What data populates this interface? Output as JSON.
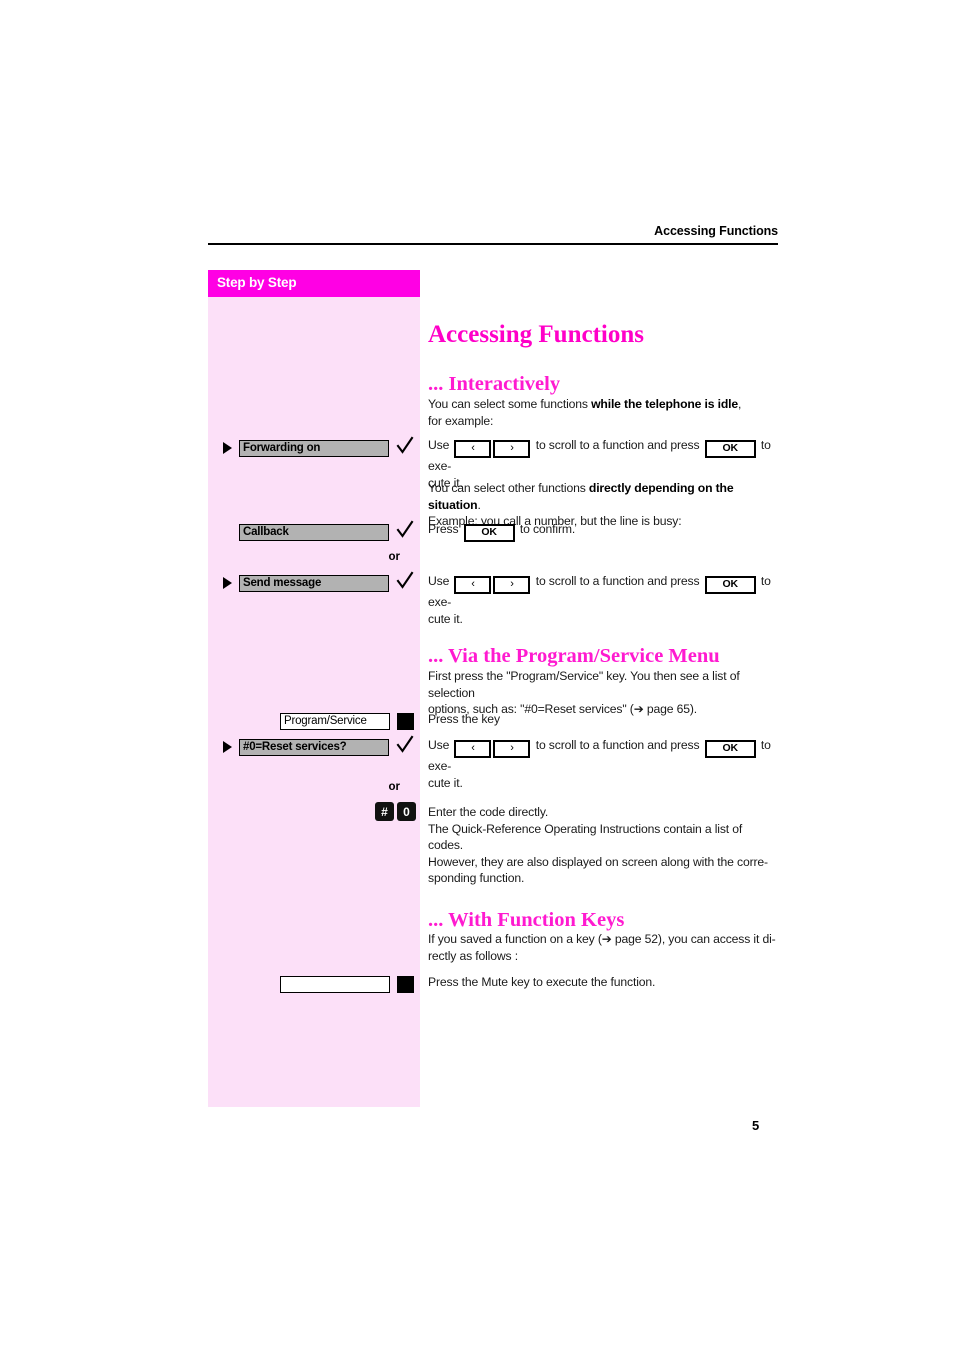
{
  "header": {
    "running_head": "Accessing Functions"
  },
  "sidebar": {
    "title": "Step by Step",
    "bg_color": "#fce0f8",
    "title_bg_color": "#ff00e4",
    "items": [
      {
        "label": "Forwarding on",
        "type": "display",
        "bullet": true,
        "check": true
      },
      {
        "label": "Callback",
        "type": "display",
        "bullet": false,
        "check": true
      },
      {
        "label": "Send message",
        "type": "display",
        "bullet": true,
        "check": true
      },
      {
        "label": "Program/Service",
        "type": "key",
        "bullet": false,
        "check": false
      },
      {
        "label": "#0=Reset services?",
        "type": "display",
        "bullet": true,
        "check": true
      },
      {
        "label": "",
        "type": "key-blank",
        "bullet": false,
        "check": false
      }
    ],
    "or_separators": [
      "or",
      "or"
    ],
    "keypad_keys": [
      "#",
      "0"
    ]
  },
  "main": {
    "title": "Accessing Functions",
    "sections": [
      {
        "heading": "... Interactively",
        "paragraphs": [
          {
            "id": "p1_a",
            "text": "You can select some functions ",
            "bold": "while the telephone is idle",
            "tail": ","
          },
          {
            "id": "p1_b",
            "text": "for example:"
          },
          {
            "id": "p2_a",
            "pre": "Use ",
            "mid": " to scroll to a function and press ",
            "post": " to exe-"
          },
          {
            "id": "p2_b",
            "text": "cute it."
          },
          {
            "id": "p3_a",
            "text": "You can select other functions ",
            "bold": "directly depending on the situation",
            "tail": "."
          },
          {
            "id": "p3_b",
            "text": "Example:  you call a number, but the line is busy:"
          },
          {
            "id": "p4",
            "pre": "Press ",
            "post": " to confirm."
          },
          {
            "id": "p5_a",
            "pre": "Use ",
            "mid": " to scroll to a function and press ",
            "post": " to exe-"
          },
          {
            "id": "p5_b",
            "text": "cute it."
          }
        ]
      },
      {
        "heading": "... Via the Program/Service Menu",
        "paragraphs": [
          {
            "id": "p6_a",
            "text": "First press the \"Program/Service\" key. You then see a list of selection"
          },
          {
            "id": "p6_b",
            "pre": "options, such as: \"#0=Reset services\" (",
            "post": " page 65)."
          },
          {
            "id": "p7",
            "text": "Press the key"
          },
          {
            "id": "p8_a",
            "pre": "Use ",
            "mid": " to scroll to a function and press ",
            "post": " to exe-"
          },
          {
            "id": "p8_b",
            "text": "cute it."
          },
          {
            "id": "p9_a",
            "text": "Enter the code directly."
          },
          {
            "id": "p9_b",
            "text": "The Quick-Reference Operating Instructions contain a list of codes."
          },
          {
            "id": "p9_c",
            "text": "However, they are also displayed on screen along with the corre-"
          },
          {
            "id": "p9_d",
            "text": "sponding function."
          }
        ]
      },
      {
        "heading": "... With Function Keys",
        "paragraphs": [
          {
            "id": "p10_a",
            "pre": "If you saved a function on a key (",
            "post": " page 52), you can access it di-"
          },
          {
            "id": "p10_b",
            "text": "rectly as follows :"
          },
          {
            "id": "p11",
            "text": "Press the Mute key to execute the function."
          }
        ]
      }
    ],
    "buttons": {
      "ok_label": "OK",
      "nav_left": "‹",
      "nav_right": "›",
      "page_arrow": "➔"
    }
  },
  "footer": {
    "page_number": "5"
  },
  "colors": {
    "magenta_heading": "#ff00c8",
    "magenta_bar": "#ff00e4",
    "sidebar_pink": "#fce0f8",
    "display_grey": "#b2b2b2",
    "text_black": "#1a1a1a"
  }
}
